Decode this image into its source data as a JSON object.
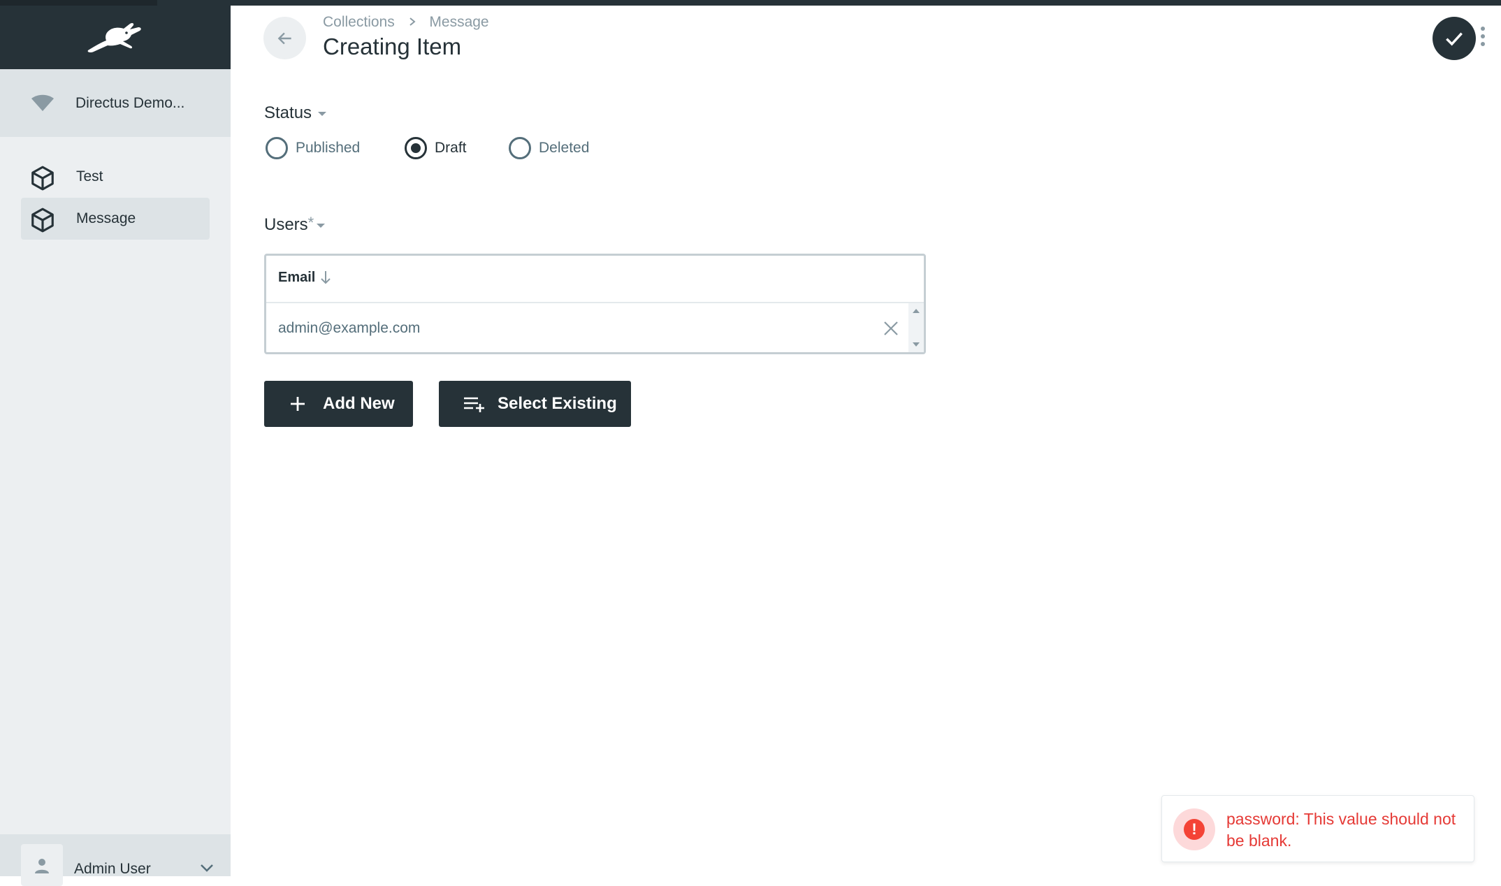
{
  "sidebar": {
    "project_name": "Directus Demo...",
    "nav": [
      {
        "label": "Test",
        "icon": "cube-icon",
        "active": false
      },
      {
        "label": "Message",
        "icon": "cube-icon",
        "active": true
      }
    ],
    "user": {
      "name": "Admin User",
      "icon": "person-icon"
    }
  },
  "header": {
    "breadcrumb": [
      "Collections",
      "Message"
    ],
    "title": "Creating Item"
  },
  "form": {
    "status": {
      "label": "Status",
      "options": [
        "Published",
        "Draft",
        "Deleted"
      ],
      "selected": "Draft"
    },
    "users": {
      "label": "Users",
      "required_mark": "*",
      "column": "Email",
      "rows": [
        "admin@example.com"
      ],
      "add_new_label": "Add New",
      "select_existing_label": "Select Existing"
    }
  },
  "toast": {
    "type": "error",
    "message": "password: This value should not be blank."
  },
  "colors": {
    "dark": "#263238",
    "sidebar_bg": "#eceff1",
    "muted": "#8a9aa3",
    "error": "#f44336"
  }
}
